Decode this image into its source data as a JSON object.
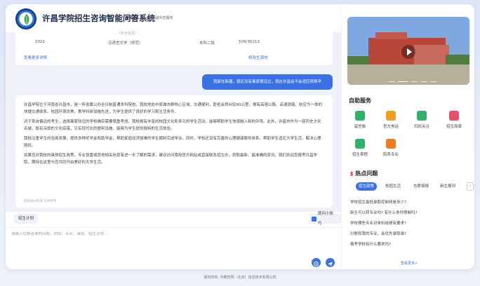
{
  "header": {
    "title": "许昌学院招生咨询智能问答系统",
    "brand": "智问小E",
    "slogan": "24小时竭诚为您服务"
  },
  "table": {
    "cutoff": "…（补全信息）…",
    "row": {
      "year": "2022",
      "major": "汉语言文学（师范）",
      "level": "本科二批",
      "score": "509/36213"
    },
    "more_link": "查看更多详情",
    "edit_link": "修改生源地"
  },
  "user_message": "我家在新疆，我还没有离家很远过，我在许昌会不会适应很艰辛",
  "bot_message": {
    "paragraphs": [
      "许昌学院位于河南省许昌市，是一所省属公办全日制普通本科院校。我校地处中原城市群核心区域，交通便利，距省会郑州仅80公里，拥有高速公路、高速铁路、航空为一体的快捷交通体系。校园环境优美，教学科研设施先进，为学生提供了良好的学习和生活条件。",
      "对于来自偏远的考生，选择离家较远的学校确实需要慎重考虑。我校拥有丰富的校园文化和多元的学生活动，能够帮助学生快速融入新的环境。此外，许昌市作为一座历史文化名城，既有深厚的文化底蕴，又有现代化的便利设施，能够为学生提供独特的生活体验。",
      "我校注重学生的全面发展，提供多种奖学金和助学金，帮助家庭经济困难的学生顺利完成学业。同时，学校还设有完善的心理健康服务体系，帮助学生适应大学生活，解决心理困扰。",
      "如果您对我校的具体招生政策、专业设置或其他相关信息有进一步了解的需求，建议访问我校官方网站或直接联系招生办，获取最新、最准确的资讯。我们欢迎您报考许昌学院，期待在这里与您共同开启美好的大学生活。"
    ],
    "note": "回答由AI生成 仅供参考"
  },
  "tools": {
    "tag": "招生计划",
    "tip": "提问小技巧"
  },
  "input": {
    "placeholder": "请输入您想咨询的问题，例如：专业、录取、招生计划..."
  },
  "services": {
    "title": "自助服务",
    "items": [
      {
        "label": "留言板",
        "color": "#2fb36b"
      },
      {
        "label": "官方电话",
        "color": "#f0a020"
      },
      {
        "label": "扫码关注",
        "color": "#2fb36b"
      },
      {
        "label": "招生简章",
        "color": "#e8506a"
      },
      {
        "label": "招生章程",
        "color": "#2fb36b"
      },
      {
        "label": "院系专业",
        "color": "#f07c20"
      }
    ]
  },
  "hot": {
    "title": "热点问题",
    "tabs": [
      "招生政策",
      "校园生活",
      "志愿填报",
      "新生报到"
    ],
    "questions": [
      "学校招生最低录取控制线是多少?",
      "新生可以转专业吗? 有什么条件限制吗?",
      "学校哪些专业对单科成绩有要求?",
      "分数和我的专业，会优先录取谁?",
      "报考学校有什么要求吗?"
    ],
    "more": "查看更多>"
  },
  "footer": "版权所有: 中教智网（北京）信息技术有限公司"
}
